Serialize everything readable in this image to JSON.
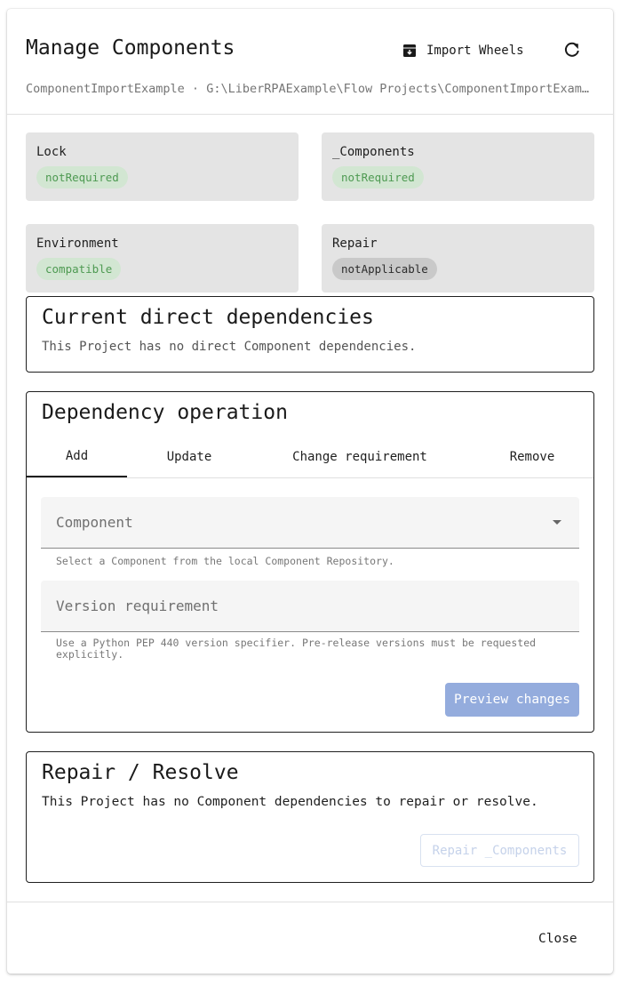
{
  "dialog": {
    "title": "Manage Components",
    "import_label": "Import Wheels",
    "subtitle": "ComponentImportExample · G:\\LiberRPAExample\\Flow Projects\\ComponentImportExample"
  },
  "status_cards": {
    "lock": {
      "label": "Lock",
      "status": "notRequired"
    },
    "components": {
      "label": "_Components",
      "status": "notRequired"
    },
    "environment": {
      "label": "Environment",
      "status": "compatible"
    },
    "repair": {
      "label": "Repair",
      "status": "notApplicable"
    }
  },
  "direct_deps": {
    "heading": "Current direct dependencies",
    "empty_text": "This Project has no direct Component dependencies."
  },
  "operation": {
    "heading": "Dependency operation",
    "tabs": [
      "Add",
      "Update",
      "Change requirement",
      "Remove"
    ],
    "active_tab": "Add",
    "component_placeholder": "Component",
    "component_hint": "Select a Component from the local Component Repository.",
    "version_placeholder": "Version requirement",
    "version_hint": "Use a Python PEP 440 version specifier. Pre-release versions must be requested explicitly.",
    "preview_label": "Preview changes"
  },
  "repair": {
    "heading": "Repair / Resolve",
    "text": "This Project has no Component dependencies to repair or resolve.",
    "button_label": "Repair _Components"
  },
  "footer": {
    "close_label": "Close"
  }
}
